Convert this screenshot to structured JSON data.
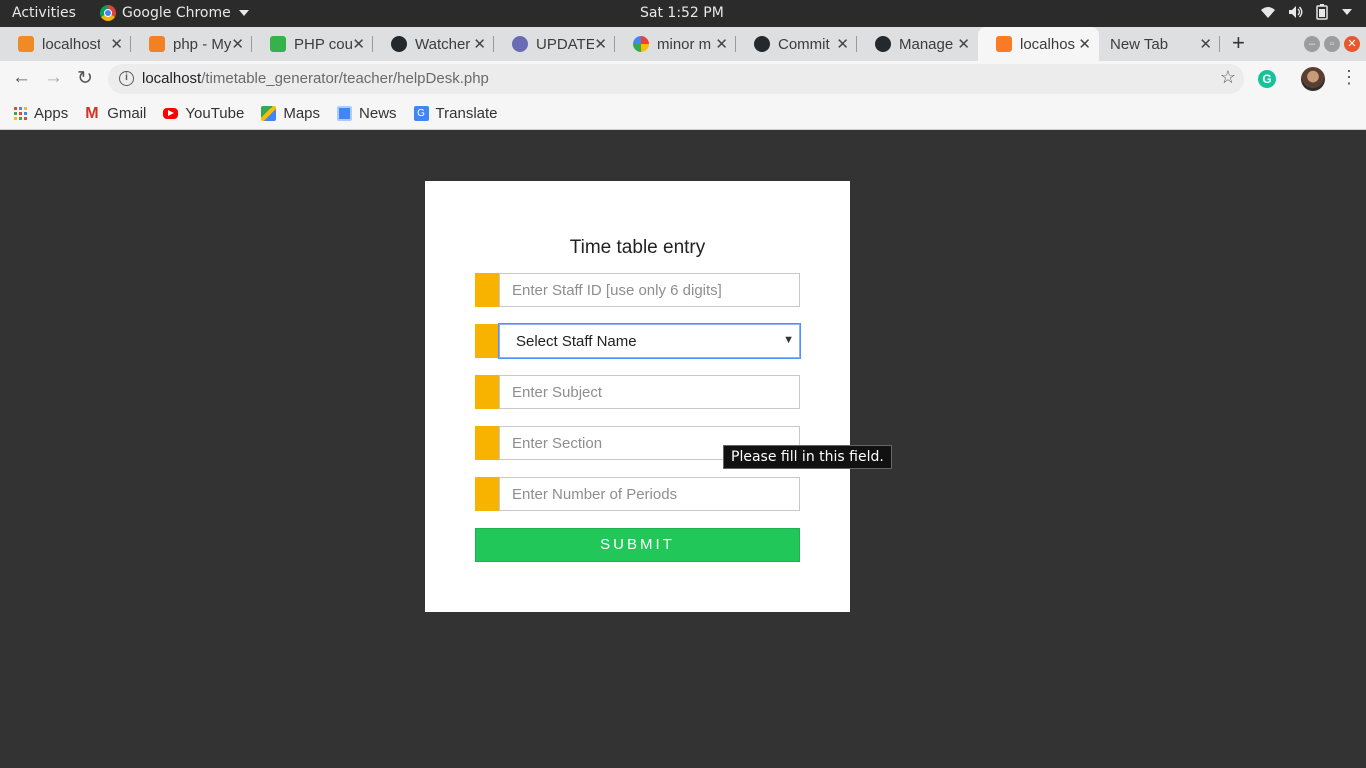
{
  "system": {
    "activities": "Activities",
    "app_name": "Google Chrome",
    "clock": "Sat  1:52 PM"
  },
  "tabs": [
    {
      "label": "localhost",
      "favicon_color": "#f08a24",
      "icon": "xampp-icon"
    },
    {
      "label": "php - My",
      "favicon_color": "#f48024",
      "icon": "stackoverflow-icon"
    },
    {
      "label": "PHP cou",
      "favicon_color": "#36b24a",
      "icon": "course-icon"
    },
    {
      "label": "Watcher",
      "favicon_color": "#24292e",
      "icon": "github-icon"
    },
    {
      "label": "UPDATE",
      "favicon_color": "#6b6bb5",
      "icon": "php-icon"
    },
    {
      "label": "minor m",
      "favicon_color": "#4285f4",
      "icon": "google-icon"
    },
    {
      "label": "Commit",
      "favicon_color": "#24292e",
      "icon": "github-icon"
    },
    {
      "label": "Manage",
      "favicon_color": "#24292e",
      "icon": "github-icon"
    },
    {
      "label": "localhos",
      "favicon_color": "#fb7a24",
      "icon": "xampp-icon",
      "active": true
    },
    {
      "label": "New Tab",
      "favicon_color": "",
      "icon": ""
    }
  ],
  "address_bar": {
    "host": "localhost",
    "path": "/timetable_generator/teacher/helpDesk.php"
  },
  "bookmarks": [
    {
      "label": "Apps",
      "icon": "apps-grid-icon"
    },
    {
      "label": "Gmail",
      "icon": "gmail-icon",
      "color": "#d93025"
    },
    {
      "label": "YouTube",
      "icon": "youtube-icon",
      "color": "#ff0000"
    },
    {
      "label": "Maps",
      "icon": "maps-icon",
      "color": "#34a853"
    },
    {
      "label": "News",
      "icon": "news-icon",
      "color": "#4285f4"
    },
    {
      "label": "Translate",
      "icon": "translate-icon",
      "color": "#4285f4"
    }
  ],
  "form": {
    "title": "Time table entry",
    "staff_id_placeholder": "Enter Staff ID [use only 6 digits]",
    "staff_name_selected": "Select Staff Name",
    "subject_placeholder": "Enter Subject",
    "section_placeholder": "Enter Section",
    "periods_placeholder": "Enter Number of Periods",
    "submit_label": "SUBMIT",
    "accent_color": "#f7b300",
    "submit_color": "#22c75a"
  },
  "validation_tooltip": "Please fill in this field."
}
